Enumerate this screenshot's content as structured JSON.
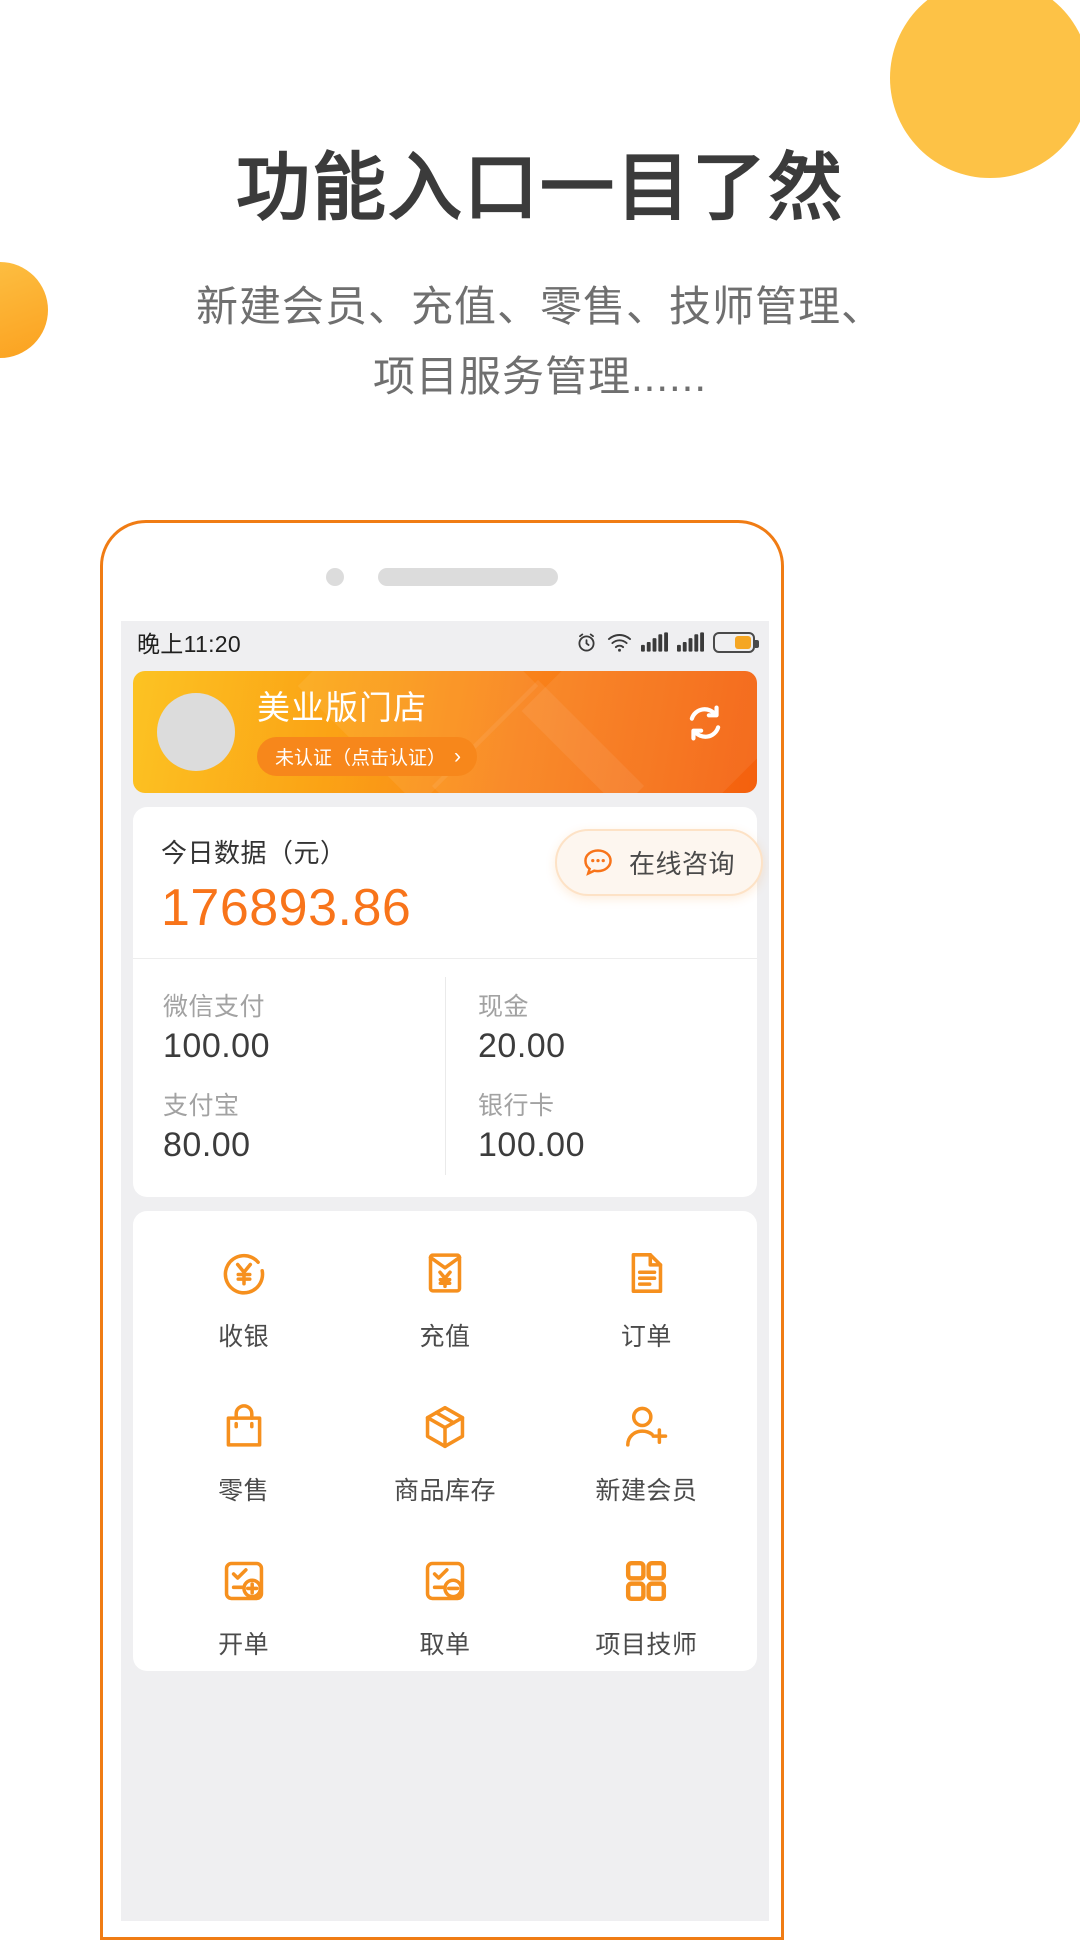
{
  "promo": {
    "headline": "功能入口一目了然",
    "subhead_line1": "新建会员、充值、零售、技师管理、",
    "subhead_line2": "项目服务管理......"
  },
  "colors": {
    "accent_orange": "#f8741a",
    "brand_gradient_start": "#fcc323",
    "brand_gradient_end": "#f4600e",
    "blob_yellow": "#fdc246",
    "frame_border": "#f07c14",
    "screen_bg": "#efeff1",
    "value_orange": "#f8741a"
  },
  "statusbar": {
    "time": "晚上11:20",
    "icons": [
      "alarm-icon",
      "wifi-icon",
      "signal-icon",
      "signal-icon",
      "battery-icon"
    ]
  },
  "store_header": {
    "avatar": "avatar-placeholder",
    "name": "美业版门店",
    "verify_badge": "未认证（点击认证）",
    "verify_chevron": "›",
    "refresh_icon": "refresh-icon"
  },
  "today_card": {
    "label": "今日数据（元）",
    "value": "176893.86",
    "consult_button": {
      "icon": "chat-bubble-icon",
      "label": "在线咨询"
    },
    "payments": [
      {
        "name": "微信支付",
        "amount": "100.00"
      },
      {
        "name": "现金",
        "amount": "20.00"
      },
      {
        "name": "支付宝",
        "amount": "80.00"
      },
      {
        "name": "银行卡",
        "amount": "100.00"
      }
    ]
  },
  "functions": [
    {
      "label": "收银",
      "icon": "yen-circle-icon"
    },
    {
      "label": "充值",
      "icon": "envelope-yen-icon"
    },
    {
      "label": "订单",
      "icon": "document-icon"
    },
    {
      "label": "零售",
      "icon": "shopping-bag-icon"
    },
    {
      "label": "商品库存",
      "icon": "box-icon"
    },
    {
      "label": "新建会员",
      "icon": "person-add-icon"
    },
    {
      "label": "开单",
      "icon": "checklist-add-icon"
    },
    {
      "label": "取单",
      "icon": "checklist-minus-icon"
    },
    {
      "label": "项目技师",
      "icon": "grid-squares-icon"
    }
  ]
}
